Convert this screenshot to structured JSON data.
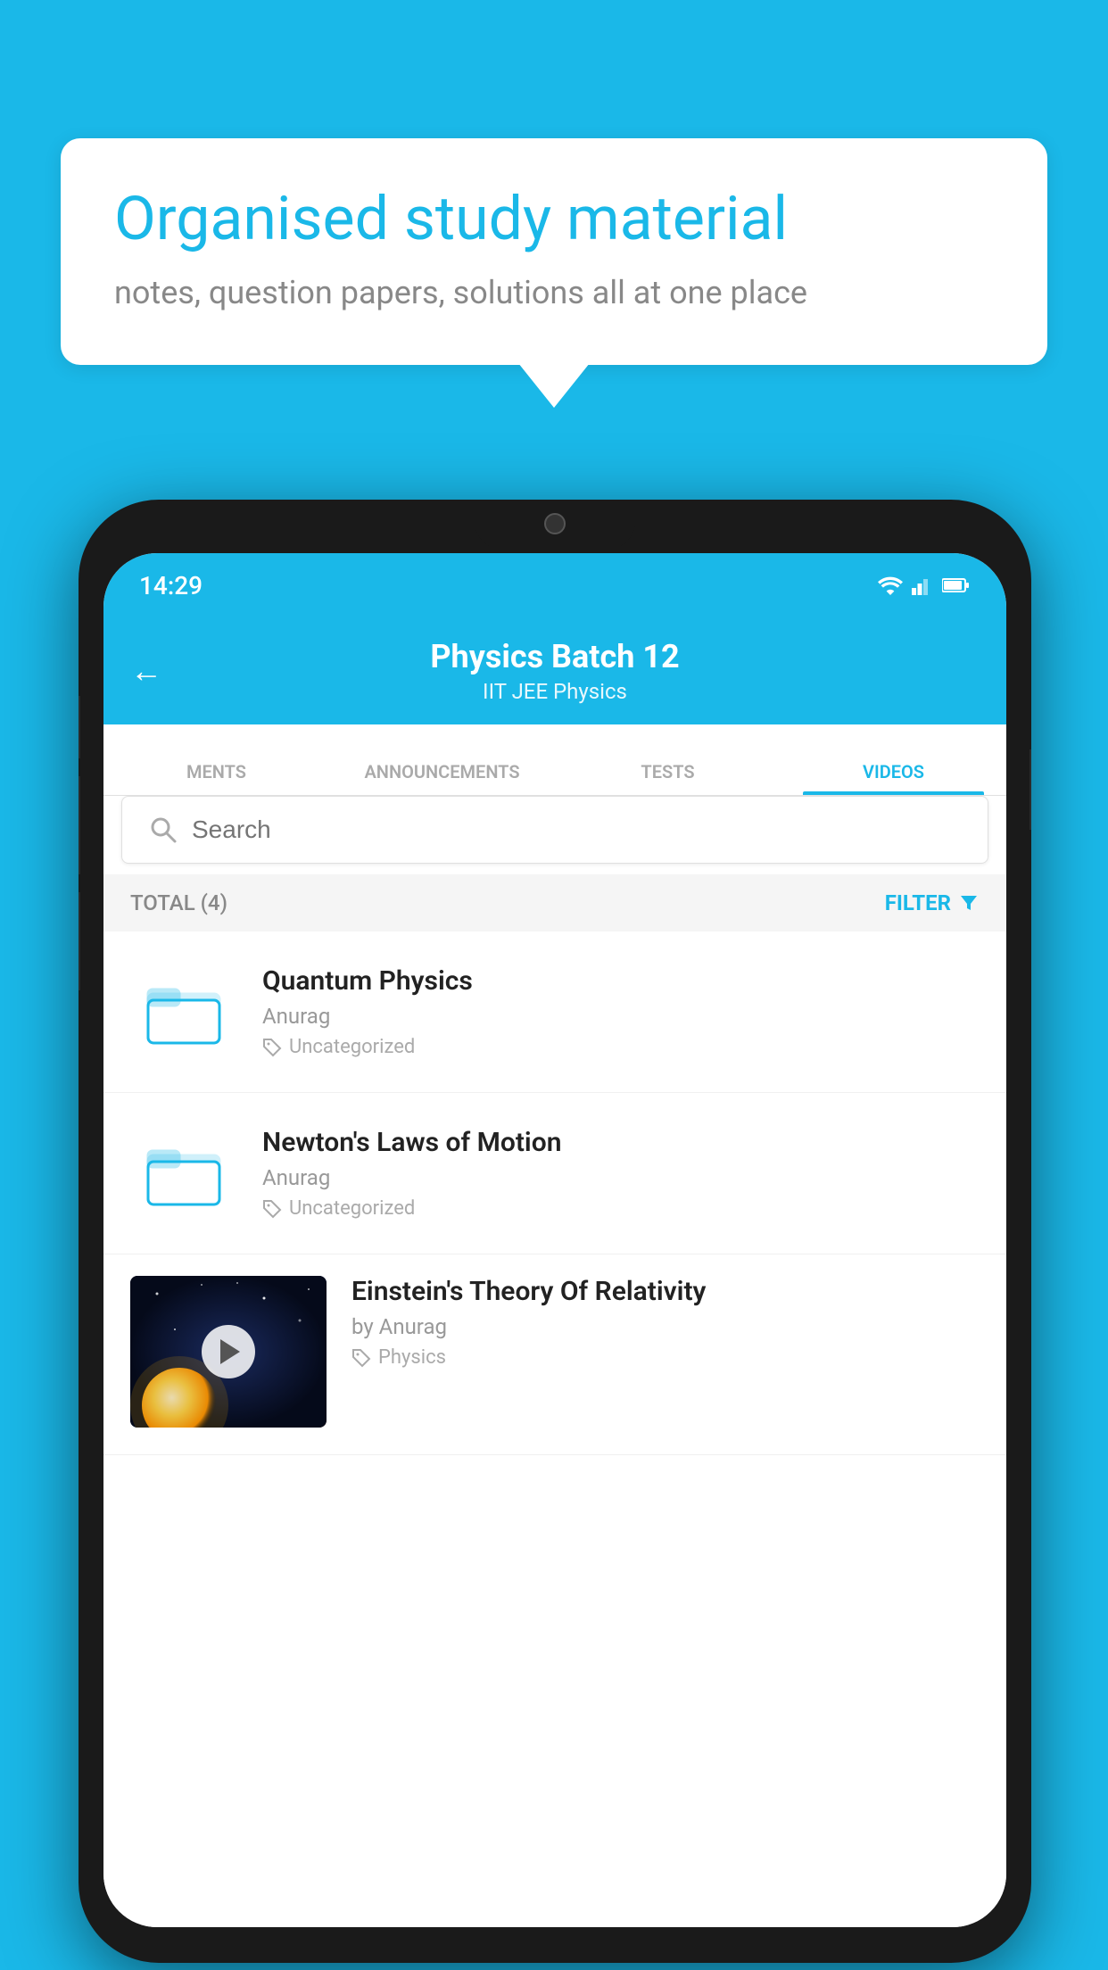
{
  "bubble": {
    "title": "Organised study material",
    "subtitle": "notes, question papers, solutions all at one place"
  },
  "phone": {
    "status": {
      "time": "14:29"
    },
    "header": {
      "back_label": "←",
      "title": "Physics Batch 12",
      "subtitle": "IIT JEE   Physics"
    },
    "tabs": [
      {
        "label": "MENTS",
        "active": false
      },
      {
        "label": "ANNOUNCEMENTS",
        "active": false
      },
      {
        "label": "TESTS",
        "active": false
      },
      {
        "label": "VIDEOS",
        "active": true
      }
    ],
    "search": {
      "placeholder": "Search"
    },
    "filter": {
      "total_label": "TOTAL (4)",
      "button_label": "FILTER"
    },
    "videos": [
      {
        "id": 1,
        "type": "folder",
        "title": "Quantum Physics",
        "author": "Anurag",
        "tag": "Uncategorized"
      },
      {
        "id": 2,
        "type": "folder",
        "title": "Newton's Laws of Motion",
        "author": "Anurag",
        "tag": "Uncategorized"
      },
      {
        "id": 3,
        "type": "video",
        "title": "Einstein's Theory Of Relativity",
        "author": "by Anurag",
        "tag": "Physics"
      }
    ]
  }
}
